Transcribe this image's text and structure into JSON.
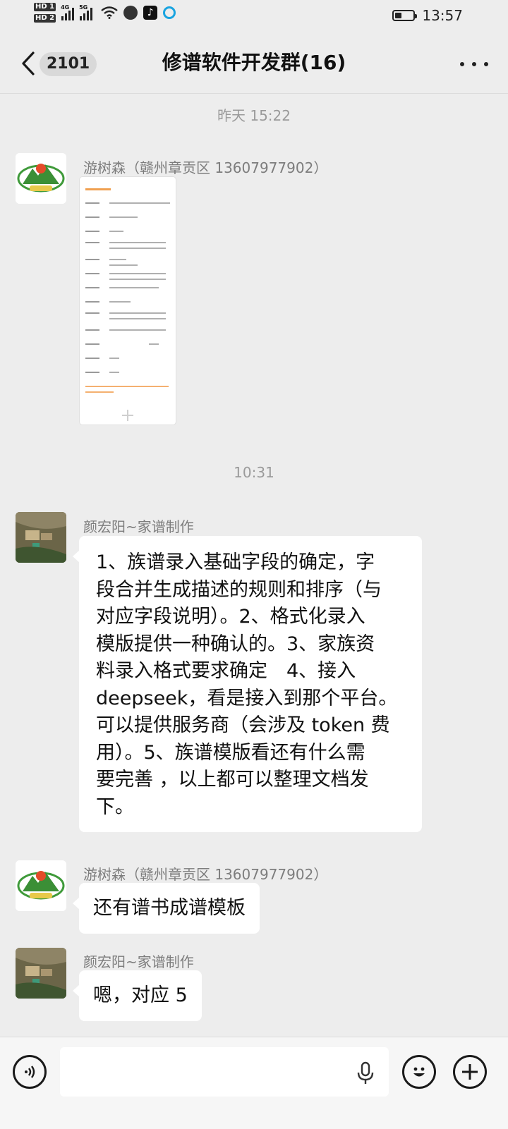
{
  "status_bar": {
    "hd1": "HD 1",
    "hd2": "HD 2",
    "sim1_network": "4G",
    "sim2_network": "5G",
    "time": "13:57",
    "battery_level": 0.35,
    "notification_icons": [
      "wifi-icon",
      "message-icon",
      "tiktok-icon",
      "ring-app-icon"
    ]
  },
  "header": {
    "back_icon": "chevron-left-icon",
    "unread_count": "2101",
    "title": "修谱软件开发群(16)",
    "more_icon": "more-dots-icon"
  },
  "chat": {
    "timestamp_1": "昨天 15:22",
    "timestamp_2": "10:31",
    "messages": [
      {
        "sender": "游树森（赣州章贡区 13607977902）",
        "type": "image",
        "avatar": "green-logo-avatar"
      },
      {
        "sender": "颜宏阳~家谱制作",
        "type": "text",
        "avatar": "aerial-photo-avatar",
        "lines": [
          "1、族谱录入基础字段的确定，字",
          "段合并生成描述的规则和排序（与",
          "对应字段说明）。2、格式化录入",
          "模版提供一种确认的。3、家族资",
          "料录入格式要求确定　4、接入",
          "deepseek，看是接入到那个平台。",
          "可以提供服务商（会涉及 token 费",
          "用）。5、族谱模版看还有什么需",
          "要完善 ，以上都可以整理文档发",
          "下。"
        ]
      },
      {
        "sender": "游树森（赣州章贡区 13607977902）",
        "type": "text",
        "avatar": "green-logo-avatar",
        "text": "还有谱书成谱模板"
      },
      {
        "sender": "颜宏阳~家谱制作",
        "type": "text",
        "avatar": "aerial-photo-avatar",
        "text": "嗯，对应 5"
      }
    ]
  },
  "input_bar": {
    "voice_icon": "voice-mode-icon",
    "mic_icon": "microphone-icon",
    "emoji_icon": "emoji-icon",
    "plus_icon": "plus-icon",
    "input_value": ""
  },
  "colors": {
    "background": "#ededed",
    "bubble": "#ffffff",
    "timestamp": "#9a9a9a",
    "sender": "#7d7d7d"
  }
}
